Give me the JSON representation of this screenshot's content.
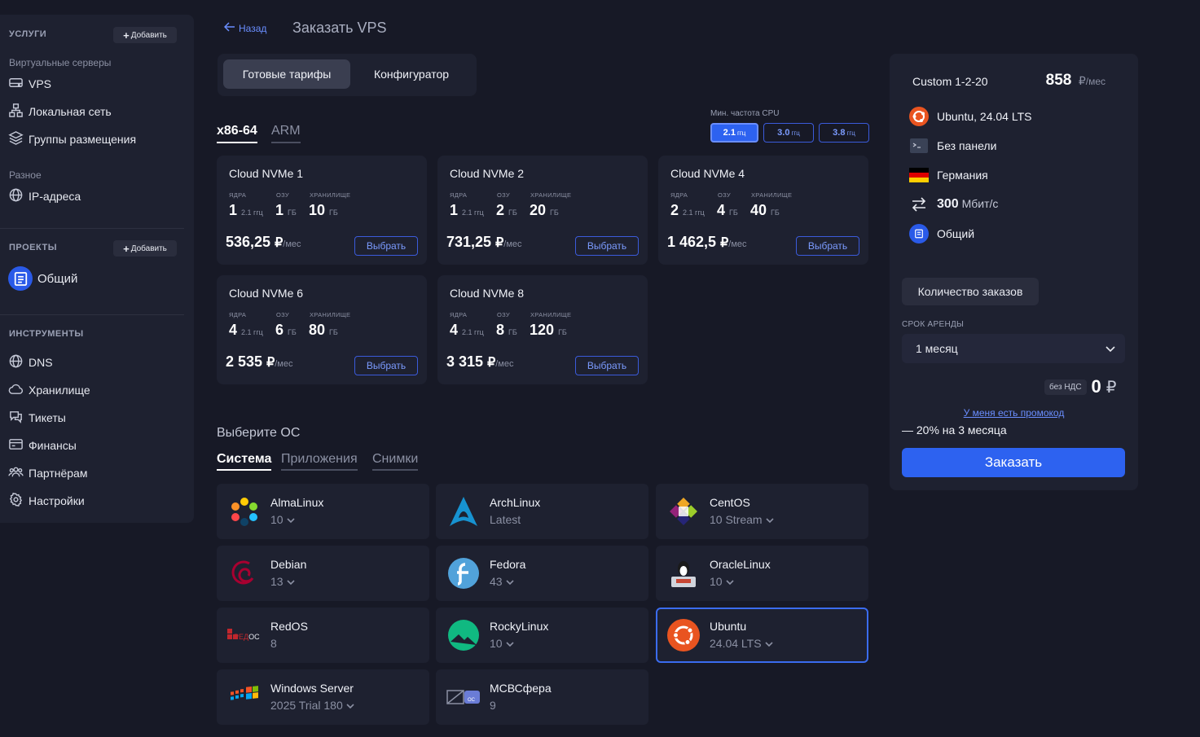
{
  "sidebar": {
    "services_heading": "УСЛУГИ",
    "add_label": "Добавить",
    "virtual_servers": "Виртуальные серверы",
    "items_main": [
      {
        "label": "VPS",
        "icon": "server-icon"
      },
      {
        "label": "Локальная сеть",
        "icon": "network-icon"
      },
      {
        "label": "Группы размещения",
        "icon": "layers-icon"
      }
    ],
    "misc": "Разное",
    "ip_label": "IP-адреса",
    "projects_heading": "ПРОЕКТЫ",
    "project_name": "Общий",
    "tools_heading": "ИНСТРУМЕНТЫ",
    "tools": [
      {
        "label": "DNS",
        "icon": "globe-icon"
      },
      {
        "label": "Хранилище",
        "icon": "cloud-icon"
      },
      {
        "label": "Тикеты",
        "icon": "chat-icon"
      },
      {
        "label": "Финансы",
        "icon": "card-icon"
      },
      {
        "label": "Партнёрам",
        "icon": "users-icon"
      },
      {
        "label": "Настройки",
        "icon": "gear-icon"
      }
    ]
  },
  "header": {
    "back": "Назад",
    "title": "Заказать VPS"
  },
  "mode_tabs": [
    "Готовые тарифы",
    "Конфигуратор"
  ],
  "arch_tabs": [
    "x86-64",
    "ARM"
  ],
  "cpu": {
    "label": "Мин. частота CPU",
    "unit": "ггц",
    "options": [
      "2.1",
      "3.0",
      "3.8"
    ],
    "selected": "2.1"
  },
  "plans": {
    "labels": {
      "cores": "ЯДРА",
      "ram": "ОЗУ",
      "storage": "ХРАНИЛИЩЕ",
      "freq": "2.1 ггц",
      "gb": "ГБ",
      "per_month": "/мес",
      "select": "Выбрать",
      "currency": "₽"
    },
    "items": [
      {
        "name": "Cloud NVMe 1",
        "cores": "1",
        "ram": "1",
        "storage": "10",
        "price": "536,25"
      },
      {
        "name": "Cloud NVMe 2",
        "cores": "1",
        "ram": "2",
        "storage": "20",
        "price": "731,25"
      },
      {
        "name": "Cloud NVMe 4",
        "cores": "2",
        "ram": "4",
        "storage": "40",
        "price": "1 462,5"
      },
      {
        "name": "Cloud NVMe 6",
        "cores": "4",
        "ram": "6",
        "storage": "80",
        "price": "2 535"
      },
      {
        "name": "Cloud NVMe 8",
        "cores": "4",
        "ram": "8",
        "storage": "120",
        "price": "3 315"
      }
    ]
  },
  "os": {
    "title": "Выберите ОС",
    "tabs": [
      "Система",
      "Приложения",
      "Снимки"
    ],
    "items": [
      {
        "name": "AlmaLinux",
        "version": "10",
        "icon": "almalinux-icon"
      },
      {
        "name": "ArchLinux",
        "version": "Latest",
        "icon": "archlinux-icon"
      },
      {
        "name": "CentOS",
        "version": "10 Stream",
        "icon": "centos-icon"
      },
      {
        "name": "Debian",
        "version": "13",
        "icon": "debian-icon"
      },
      {
        "name": "Fedora",
        "version": "43",
        "icon": "fedora-icon"
      },
      {
        "name": "OracleLinux",
        "version": "10",
        "icon": "oraclelinux-icon"
      },
      {
        "name": "RedOS",
        "version": "8",
        "icon": "redos-icon",
        "logo_text": "РЕДОС"
      },
      {
        "name": "RockyLinux",
        "version": "10",
        "icon": "rockylinux-icon"
      },
      {
        "name": "Ubuntu",
        "version": "24.04 LTS",
        "icon": "ubuntu-icon"
      },
      {
        "name": "Windows Server",
        "version": "2025 Trial 180",
        "icon": "windows-icon"
      },
      {
        "name": "МСВСфера",
        "version": "9",
        "icon": "msvsphere-icon",
        "logo_text": "ОС"
      }
    ]
  },
  "summary": {
    "config": "Custom 1-2-20",
    "price": "858",
    "currency": "₽",
    "per_month": "/мес",
    "os": "Ubuntu, 24.04 LTS",
    "panel": "Без панели",
    "location": "Германия",
    "speed": "300",
    "speed_unit": "Мбит/с",
    "project": "Общий",
    "qty_button": "Количество заказов",
    "term_label": "СРОК АРЕНДЫ",
    "term_value": "1 месяц",
    "vat_badge": "без НДС",
    "total": "0",
    "promo": "У меня есть промокод",
    "discount": "— 20% на 3 месяца",
    "order": "Заказать"
  },
  "colors": {
    "accent": "#2d62f0",
    "bg": "#171926",
    "card": "#1e2130"
  }
}
